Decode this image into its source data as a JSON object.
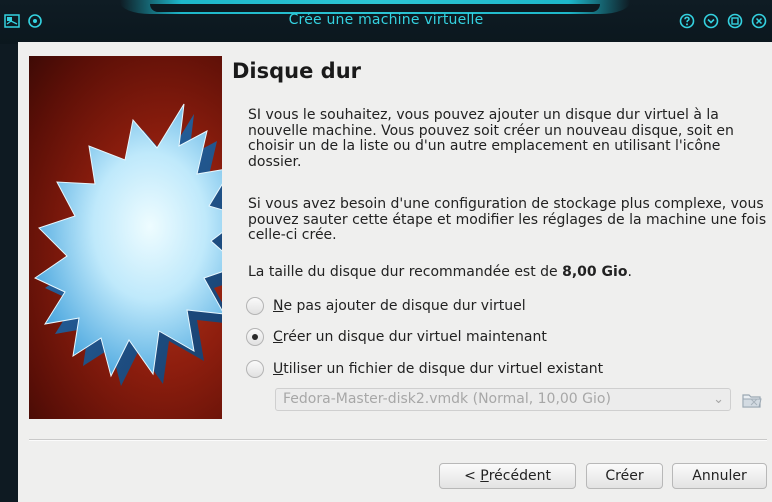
{
  "window": {
    "title": "Crée une machine virtuelle",
    "icons": [
      "app-menu-icon",
      "pin-icon",
      "help-icon",
      "minimize-icon",
      "maximize-icon",
      "close-icon"
    ]
  },
  "page": {
    "heading": "Disque dur",
    "paragraph1": "SI vous le souhaitez, vous pouvez ajouter un disque dur virtuel à la nouvelle machine. Vous pouvez soit créer un nouveau disque, soit en choisir un de la liste ou d'un autre emplacement en utilisant l'icône dossier.",
    "paragraph2": "Si vous avez besoin d'une configuration de stockage plus complexe, vous pouvez sauter cette étape et modifier les réglages de la machine une fois celle-ci crée.",
    "recommend_prefix": "La taille du disque dur recommandée est de ",
    "recommend_size": "8,00 Gio",
    "recommend_suffix": "."
  },
  "options": [
    {
      "mnemonic": "N",
      "rest": "e pas ajouter de disque dur virtuel",
      "checked": false
    },
    {
      "mnemonic": "C",
      "rest": "réer un disque dur virtuel maintenant",
      "checked": true
    },
    {
      "mnemonic": "U",
      "rest": "tiliser un fichier de disque dur virtuel existant",
      "checked": false
    }
  ],
  "existing_file": {
    "selected": "Fedora-Master-disk2.vmdk (Normal, 10,00 Gio)",
    "enabled": false
  },
  "buttons": {
    "prev_prefix": "< ",
    "prev_mnemonic": "P",
    "prev_rest": "récédent",
    "create": "Créer",
    "cancel": "Annuler"
  },
  "colors": {
    "titlebar_accent": "#34d2e0",
    "dialog_bg": "#efefee",
    "art_red": "#8e1e0e"
  }
}
